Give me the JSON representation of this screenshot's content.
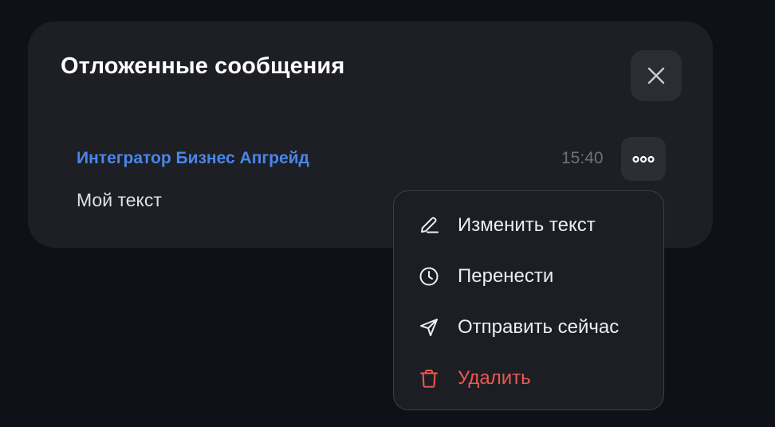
{
  "panel": {
    "title": "Отложенные сообщения",
    "close_icon": "close-icon"
  },
  "message": {
    "author": "Интегратор Бизнес Апгрейд",
    "time": "15:40",
    "text": "Мой текст",
    "more_icon": "more-horizontal-icon"
  },
  "menu": {
    "items": [
      {
        "label": "Изменить текст",
        "icon": "pencil-icon"
      },
      {
        "label": "Перенести",
        "icon": "clock-icon"
      },
      {
        "label": "Отправить сейчас",
        "icon": "send-icon"
      },
      {
        "label": "Удалить",
        "icon": "trash-icon",
        "color": "#ea5a4e"
      }
    ]
  },
  "colors": {
    "background": "#0e1118",
    "panel": "#1d1f25",
    "author_accent": "#4a86e8",
    "danger": "#ea5a4e"
  }
}
